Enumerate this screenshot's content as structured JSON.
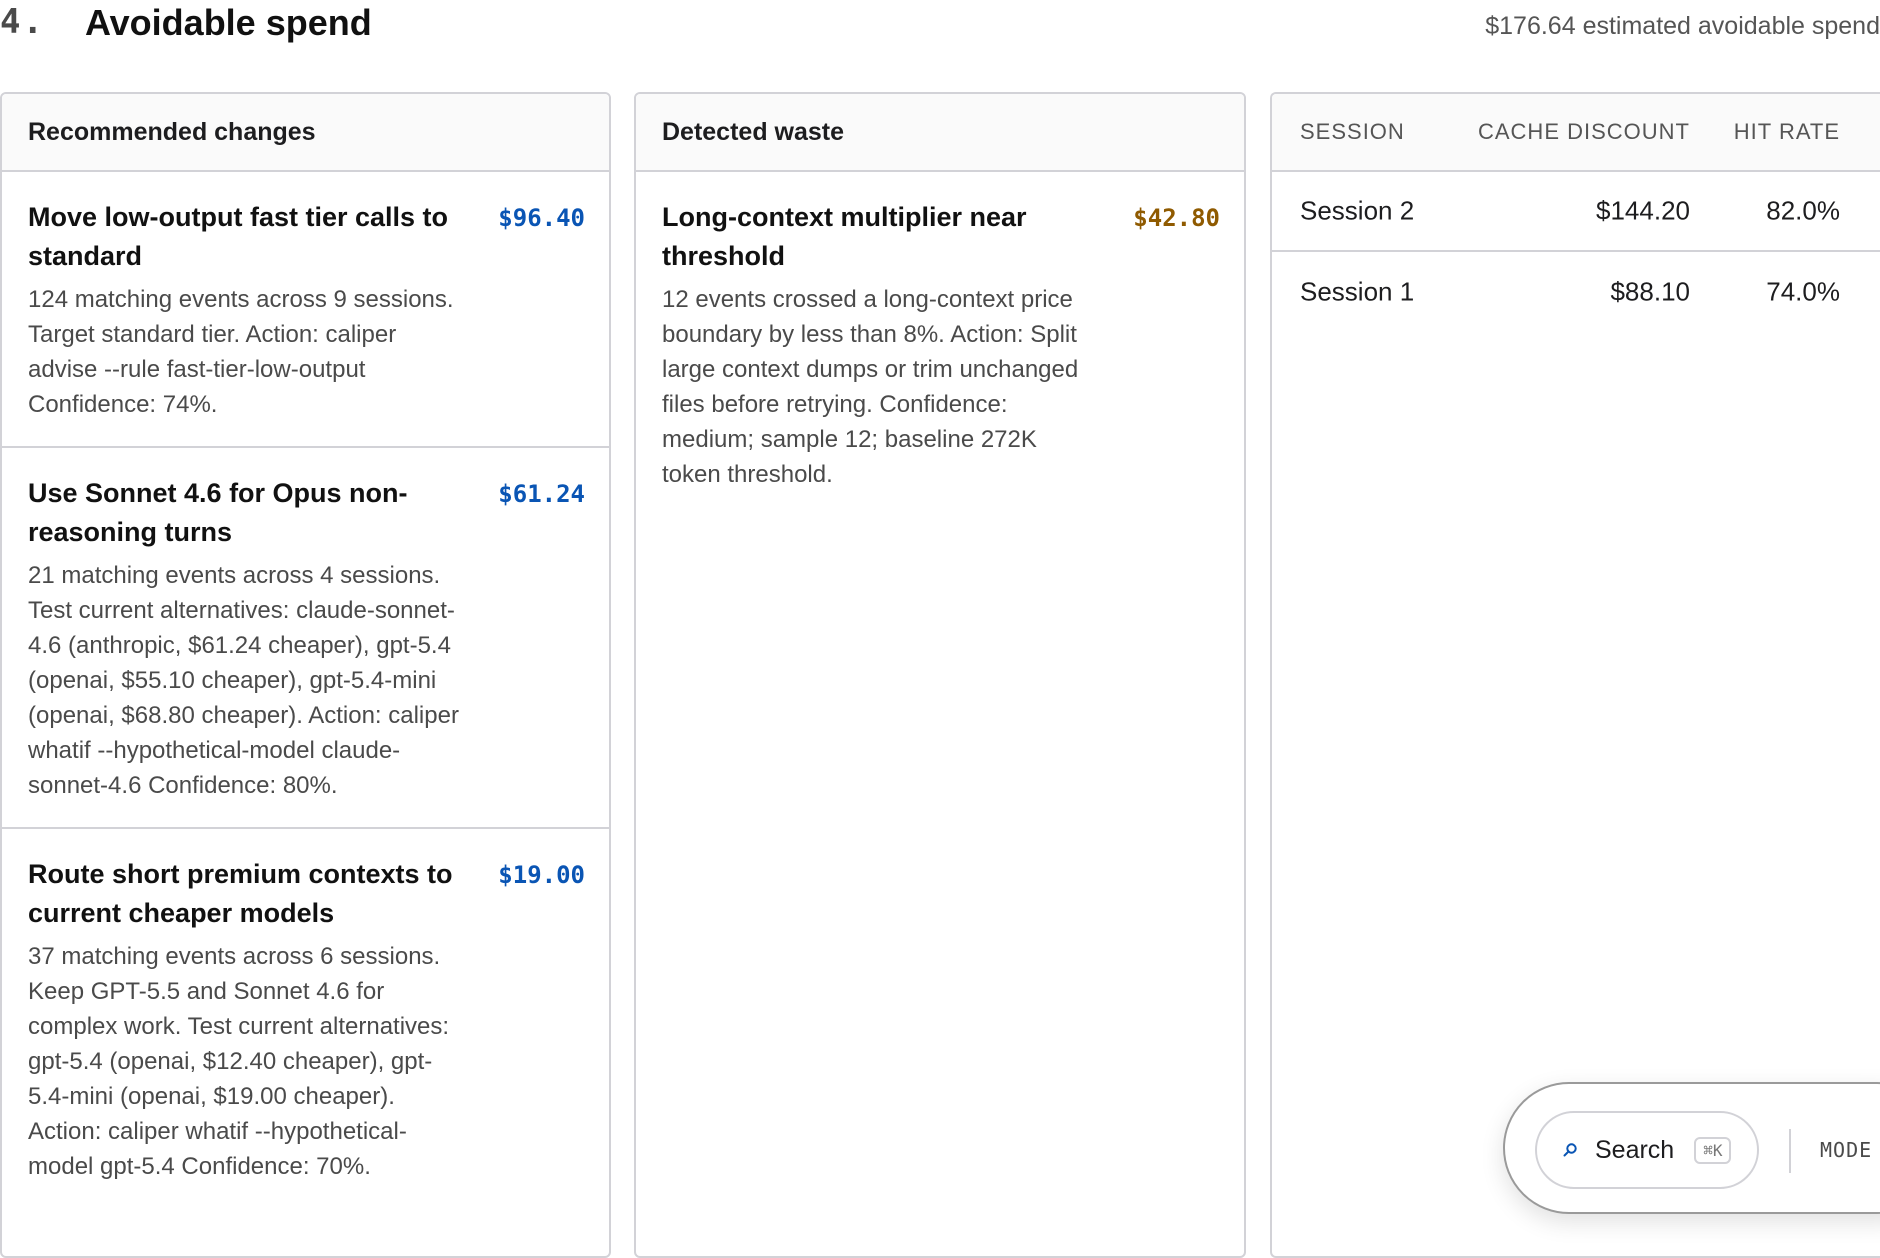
{
  "section": {
    "number": "4.",
    "title": "Avoidable spend",
    "summary": "$176.64 estimated avoidable spend"
  },
  "recommended": {
    "header": "Recommended changes",
    "items": [
      {
        "title": "Move low-output fast tier calls to standard",
        "amount": "$96.40",
        "description": "124 matching events across 9 sessions. Target standard tier. Action: caliper advise --rule fast-tier-low-output Confidence: 74%."
      },
      {
        "title": "Use Sonnet 4.6 for Opus non-reasoning turns",
        "amount": "$61.24",
        "description": "21 matching events across 4 sessions. Test current alternatives: claude-sonnet-4.6 (anthropic, $61.24 cheaper), gpt-5.4 (openai, $55.10 cheaper), gpt-5.4-mini (openai, $68.80 cheaper). Action: caliper whatif --hypothetical-model claude-sonnet-4.6 Confidence: 80%."
      },
      {
        "title": "Route short premium contexts to current cheaper models",
        "amount": "$19.00",
        "description": "37 matching events across 6 sessions. Keep GPT-5.5 and Sonnet 4.6 for complex work. Test current alternatives: gpt-5.4 (openai, $12.40 cheaper), gpt-5.4-mini (openai, $19.00 cheaper). Action: caliper whatif --hypothetical-model gpt-5.4 Confidence: 70%."
      }
    ]
  },
  "waste": {
    "header": "Detected waste",
    "items": [
      {
        "title": "Long-context multiplier near threshold",
        "amount": "$42.80",
        "description": "12 events crossed a long-context price boundary by less than 8%. Action: Split large context dumps or trim unchanged files before retrying. Confidence: medium; sample 12; baseline 272K token threshold."
      }
    ]
  },
  "sessions": {
    "columns": {
      "session": "SESSION",
      "discount": "CACHE DISCOUNT",
      "hit_rate": "HIT RATE"
    },
    "rows": [
      {
        "session": "Session 2",
        "discount": "$144.20",
        "hit_rate": "82.0%"
      },
      {
        "session": "Session 1",
        "discount": "$88.10",
        "hit_rate": "74.0%"
      }
    ]
  },
  "toolbar": {
    "search_label": "Search",
    "search_shortcut": "⌘K",
    "mode_label": "MODE",
    "search_icon": "search-icon"
  },
  "colors": {
    "accent_blue": "#0a55b4",
    "warning_amber": "#8f5a00",
    "border": "#d2d2d7"
  }
}
